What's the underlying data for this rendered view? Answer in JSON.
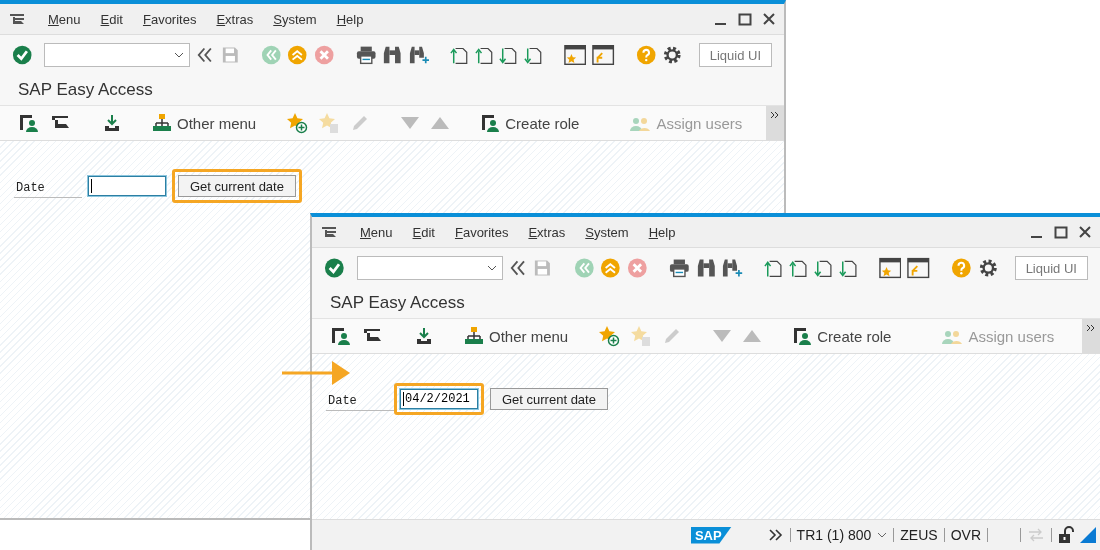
{
  "windows": [
    {
      "menu": [
        {
          "label": "Menu"
        },
        {
          "label": "Edit"
        },
        {
          "label": "Favorites"
        },
        {
          "label": "Extras"
        },
        {
          "label": "System"
        },
        {
          "label": "Help"
        }
      ],
      "liquid_ui_button": "Liquid UI",
      "title": "SAP Easy Access",
      "app_toolbar": [
        {
          "label": "Other menu",
          "disabled": false
        },
        {
          "label": "Create role",
          "disabled": false
        },
        {
          "label": "Assign users",
          "disabled": true
        }
      ],
      "date_field": {
        "label": "Date",
        "highlighted": false,
        "focused": true
      },
      "date_button": {
        "label": "Get current date",
        "highlighted": true
      },
      "pointer_arrow": false
    },
    {
      "menu": [
        {
          "label": "Menu"
        },
        {
          "label": "Edit"
        },
        {
          "label": "Favorites"
        },
        {
          "label": "Extras"
        },
        {
          "label": "System"
        },
        {
          "label": "Help"
        }
      ],
      "liquid_ui_button": "Liquid UI",
      "title": "SAP Easy Access",
      "app_toolbar": [
        {
          "label": "Other menu",
          "disabled": false
        },
        {
          "label": "Create role",
          "disabled": false
        },
        {
          "label": "Assign users",
          "disabled": true
        }
      ],
      "date_field": {
        "label": "Date",
        "value": "04/2/2021",
        "highlighted": true,
        "focused": true
      },
      "date_button": {
        "label": "Get current date",
        "highlighted": false
      },
      "pointer_arrow": true,
      "status_bar": {
        "logo": "SAP",
        "system": "TR1 (1) 800",
        "server": "ZEUS",
        "mode": "OVR"
      }
    }
  ]
}
